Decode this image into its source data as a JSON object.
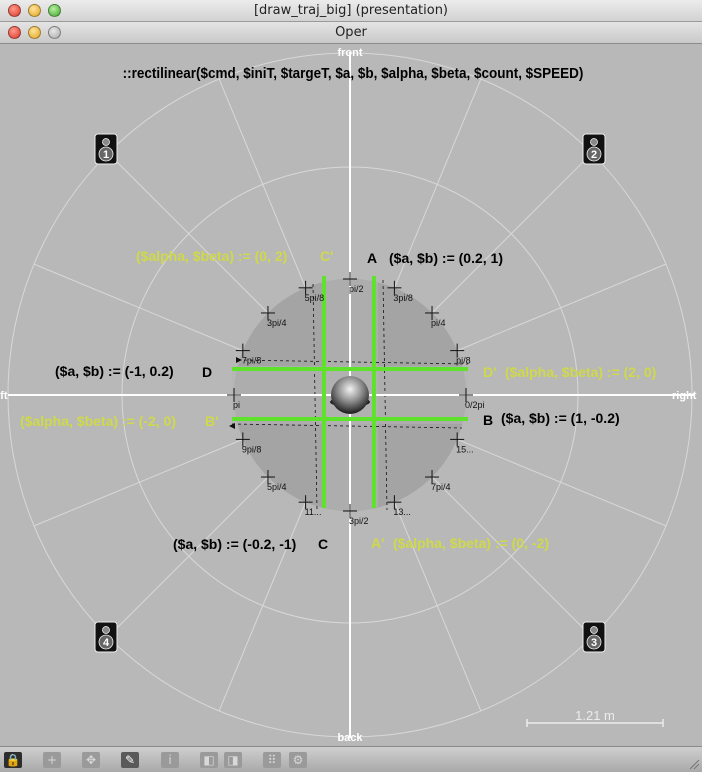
{
  "window": {
    "title": "[draw_traj_big] (presentation)",
    "subtitle": "Oper"
  },
  "colors": {
    "background": "#b8b8b8",
    "annotation_green": "#cfd94a",
    "trajectory_green": "#5fe22b",
    "grid_line": "#dcdcdc",
    "axis": "#ffffff"
  },
  "canvas": {
    "formula": "::rectilinear($cmd,  $iniT, $targeT,  $a, $b,  $alpha, $beta,  $count, $SPEED)",
    "axes": {
      "front": "front",
      "back": "back",
      "left": "left",
      "right": "right"
    },
    "speakers": [
      "1",
      "2",
      "3",
      "4"
    ],
    "angle_labels": {
      "a0": "0/2pi",
      "a1": "pi/8",
      "a2": "pi/4",
      "a3": "3pi/8",
      "a4": "pi/2",
      "a5": "5pi/8",
      "a6": "3pi/4",
      "a7": "7pi/8",
      "a8": "pi",
      "a9": "9pi/8",
      "a10": "5pi/4",
      "a11": "11...",
      "a12": "3pi/2",
      "a13": "13...",
      "a14": "7pi/4",
      "a15": "15..."
    },
    "annotations": {
      "A": "A",
      "A_ab": "($a, $b) := (0.2, 1)",
      "B": "B",
      "B_ab": "($a, $b) := (1, -0.2)",
      "C": "C",
      "C_ab": "($a, $b) := (-0.2, -1)",
      "D": "D",
      "D_ab": "($a, $b) :=  (-1, 0.2)",
      "Cp": "C'",
      "Cp_ab": "($alpha,  $beta) := (0, 2)",
      "Dp": "D'",
      "Dp_ab": "($alpha,  $beta) := (2, 0)",
      "Bp": "B'",
      "Bp_ab": "($alpha,  $beta) := (-2, 0)",
      "Ap": "A'",
      "Ap_ab": "($alpha,  $beta) := (0, -2)"
    },
    "scale": "1.21 m"
  },
  "toolbar": {
    "buttons": [
      {
        "name": "lock-button",
        "glyph": "🔒"
      },
      {
        "name": "add-button",
        "glyph": "+"
      },
      {
        "name": "move-button",
        "glyph": "✥"
      },
      {
        "name": "edit-mode-button",
        "glyph": "✎"
      },
      {
        "name": "info-button",
        "glyph": "i"
      },
      {
        "name": "back-layer-button",
        "glyph": "◧"
      },
      {
        "name": "front-layer-button",
        "glyph": "◨"
      },
      {
        "name": "grid-button",
        "glyph": "⠿"
      },
      {
        "name": "settings-button",
        "glyph": "⚙"
      }
    ]
  }
}
